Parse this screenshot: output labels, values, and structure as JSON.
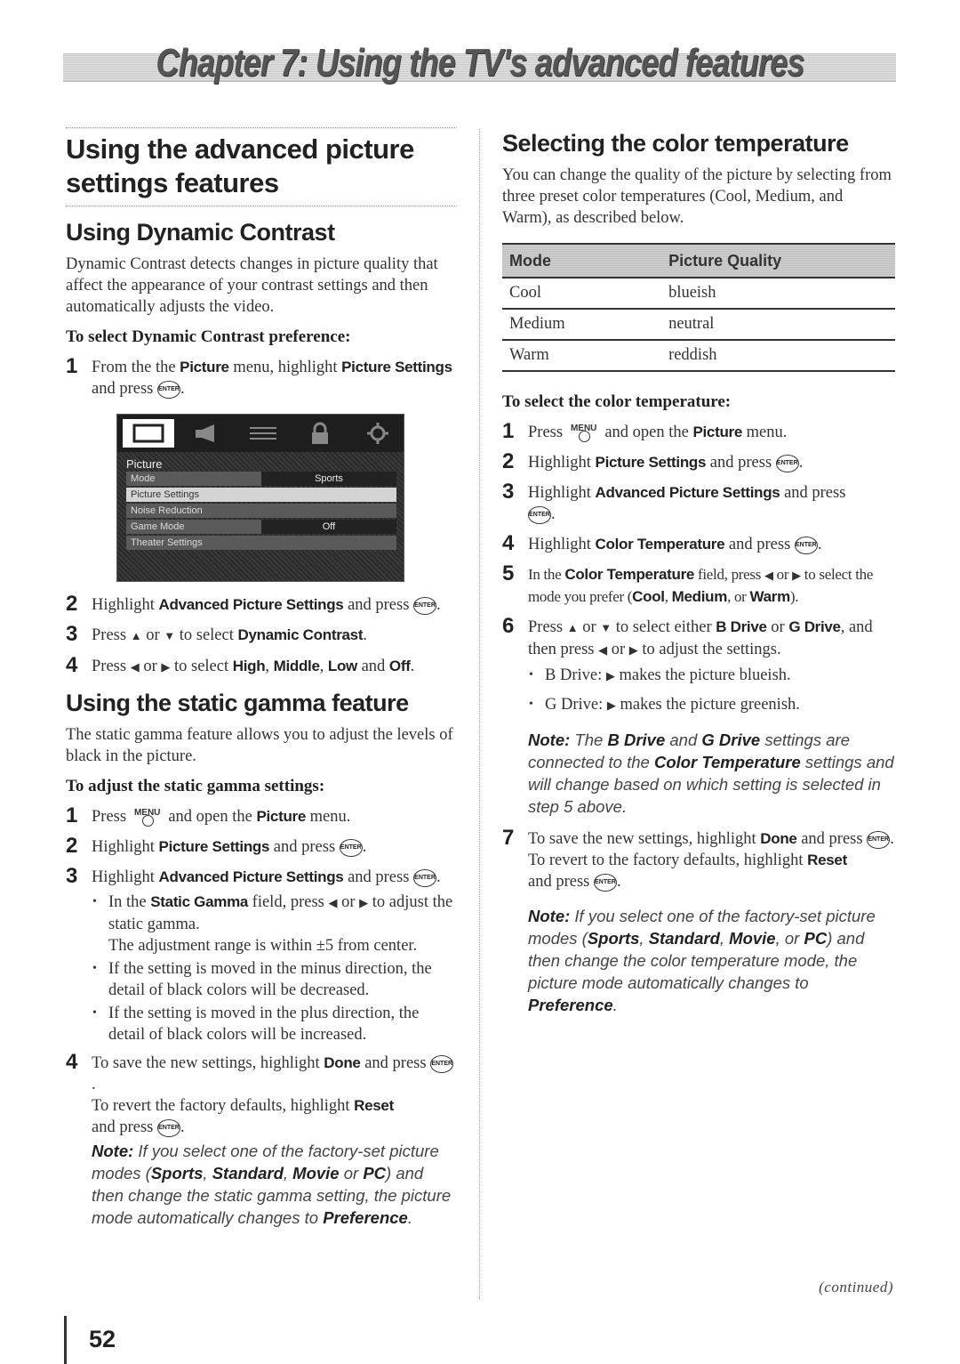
{
  "chapter_banner": "Chapter 7: Using the TV's advanced features",
  "left": {
    "title": "Using the advanced picture settings features",
    "dynamic_contrast": {
      "heading": "Using Dynamic Contrast",
      "intro": "Dynamic Contrast detects changes in picture quality that affect the appearance of your contrast settings and then automatically adjusts the video.",
      "procedure_heading": "To select Dynamic Contrast preference:",
      "step1": {
        "n": "1",
        "t1": "From the the ",
        "b1": "Picture",
        "t2": " menu, highlight ",
        "b2": "Picture Settings",
        "t3": " and press ",
        ".": "."
      },
      "step2": {
        "n": "2",
        "t1": "Highlight ",
        "b1": "Advanced Picture Settings",
        "t2": " and press "
      },
      "step3": {
        "n": "3",
        "t1": "Press ",
        "up": "▲",
        "or": " or ",
        "down": "▼",
        "t2": " to select ",
        "b1": "Dynamic Contrast",
        "t3": "."
      },
      "step4": {
        "n": "4",
        "t1": "Press ",
        "left": "◀",
        "or": " or ",
        "right": "▶",
        "t2": " to select ",
        "b1": "High",
        "c1": ", ",
        "b2": "Middle",
        "c2": ", ",
        "b3": "Low",
        "t3": " and ",
        "b4": "Off",
        "t4": "."
      }
    },
    "tv_menu": {
      "tabs": [
        "picture-icon",
        "audio-icon",
        "preferences-icon",
        "lock-icon",
        "setup-icon"
      ],
      "title": "Picture",
      "rows": [
        {
          "label": "Mode",
          "value": "Sports"
        },
        {
          "label": "Picture Settings",
          "value": ""
        },
        {
          "label": "Noise Reduction",
          "value": ""
        },
        {
          "label": "Game Mode",
          "value": "Off"
        },
        {
          "label": "Theater Settings",
          "value": ""
        }
      ],
      "highlighted_row": "Picture Settings"
    },
    "static_gamma": {
      "heading": "Using the static gamma feature",
      "intro": "The static gamma feature allows you to adjust the levels of black in the picture.",
      "procedure_heading": "To adjust the static gamma settings:",
      "step1": {
        "n": "1",
        "t1": "Press ",
        "menu": "MENU",
        "t2": " and open the ",
        "b1": "Picture",
        "t3": " menu."
      },
      "step2": {
        "n": "2",
        "t1": "Highlight ",
        "b1": "Picture Settings",
        "t2": " and press "
      },
      "step3": {
        "n": "3",
        "t1": "Highlight ",
        "b1": "Advanced Picture Settings",
        "t2": " and press "
      },
      "bullets": [
        {
          "t1": "In the ",
          "b1": "Static Gamma",
          "t2": " field, press ",
          "left": "◀",
          "or": " or ",
          "right": "▶",
          "t3": " to adjust the static gamma.",
          "t4": "The adjustment range is within ±5 from center."
        },
        {
          "t1": "If the setting is moved in the minus direction, the detail of black colors will be decreased."
        },
        {
          "t1": "If the setting is moved in the plus direction, the detail of black colors will be increased."
        }
      ],
      "step4": {
        "n": "4",
        "t1": "To save the new settings, highlight ",
        "b1": "Done",
        "t2": " and press ",
        "t3": "To revert the factory defaults, highlight ",
        "b2": "Reset",
        "t4": "and press "
      },
      "note": {
        "label": "Note:",
        "t1": " If you select one of the factory-set picture modes (",
        "b1": "Sports",
        "c1": ", ",
        "b2": "Standard",
        "c2": ", ",
        "b3": "Movie",
        "t2": " or ",
        "b4": "PC",
        "t3": ") and then change the static gamma setting, the picture mode automatically changes to ",
        "b5": "Preference",
        "t4": "."
      }
    }
  },
  "right": {
    "heading": "Selecting the color temperature",
    "intro": "You can change the quality of the picture by selecting from three preset color temperatures (Cool, Medium, and Warm), as described below.",
    "table": {
      "headers": [
        "Mode",
        "Picture Quality"
      ],
      "rows": [
        [
          "Cool",
          "blueish"
        ],
        [
          "Medium",
          "neutral"
        ],
        [
          "Warm",
          "reddish"
        ]
      ]
    },
    "procedure_heading": "To select the color temperature:",
    "step1": {
      "n": "1",
      "t1": "Press ",
      "menu": "MENU",
      "t2": " and open the ",
      "b1": "Picture",
      "t3": " menu."
    },
    "step2": {
      "n": "2",
      "t1": "Highlight ",
      "b1": "Picture Settings",
      "t2": " and press "
    },
    "step3": {
      "n": "3",
      "t1": "Highlight ",
      "b1": "Advanced Picture Settings",
      "t2": " and press"
    },
    "step4": {
      "n": "4",
      "t1": "Highlight ",
      "b1": "Color Temperature",
      "t2": " and press "
    },
    "step5": {
      "n": "5",
      "t1": "In the ",
      "b1": "Color Temperature",
      "t2": " field, press ",
      "left": "◀",
      "or": " or ",
      "right": "▶",
      "t3": " to select the mode you prefer (",
      "b2": "Cool",
      "c1": ", ",
      "b3": "Medium",
      "c2": ", or ",
      "b4": "Warm",
      "t4": ")."
    },
    "step6": {
      "n": "6",
      "t1": "Press ",
      "up": "▲",
      "or": " or ",
      "down": "▼",
      "t2": " to select either ",
      "b1": "B Drive",
      "t3": " or ",
      "b2": "G Drive",
      "t4": ", and then press ",
      "left": "◀",
      "or2": " or ",
      "right": "▶",
      "t5": " to adjust the settings."
    },
    "bullets": [
      {
        "t1": "B Drive: ",
        "arrow": "▶",
        "t2": " makes the picture blueish."
      },
      {
        "t1": "G Drive: ",
        "arrow": "▶",
        "t2": " makes the picture greenish."
      }
    ],
    "note1": {
      "label": "Note:",
      "t1": " The ",
      "b1": "B Drive",
      "t2": " and ",
      "b2": "G Drive",
      "t3": " settings are connected to the ",
      "b3": "Color Temperature",
      "t4": " settings and will change based on which setting is selected in step 5 above."
    },
    "step7": {
      "n": "7",
      "t1": "To save the new settings, highlight ",
      "b1": "Done",
      "t2": " and press ",
      "t3": "To revert to the factory defaults, highlight ",
      "b2": "Reset",
      "t4": "and press "
    },
    "note2": {
      "label": "Note:",
      "t1": " If you select one of the factory-set picture modes (",
      "b1": "Sports",
      "c1": ", ",
      "b2": "Standard",
      "c2": ", ",
      "b3": "Movie",
      "t2": ", or ",
      "b4": "PC",
      "t3": ") and then change the color temperature mode, the picture mode automatically changes to ",
      "b5": "Preference",
      "t4": "."
    }
  },
  "enter_label": "ENTER",
  "continued": "(continued)",
  "page_number": "52"
}
